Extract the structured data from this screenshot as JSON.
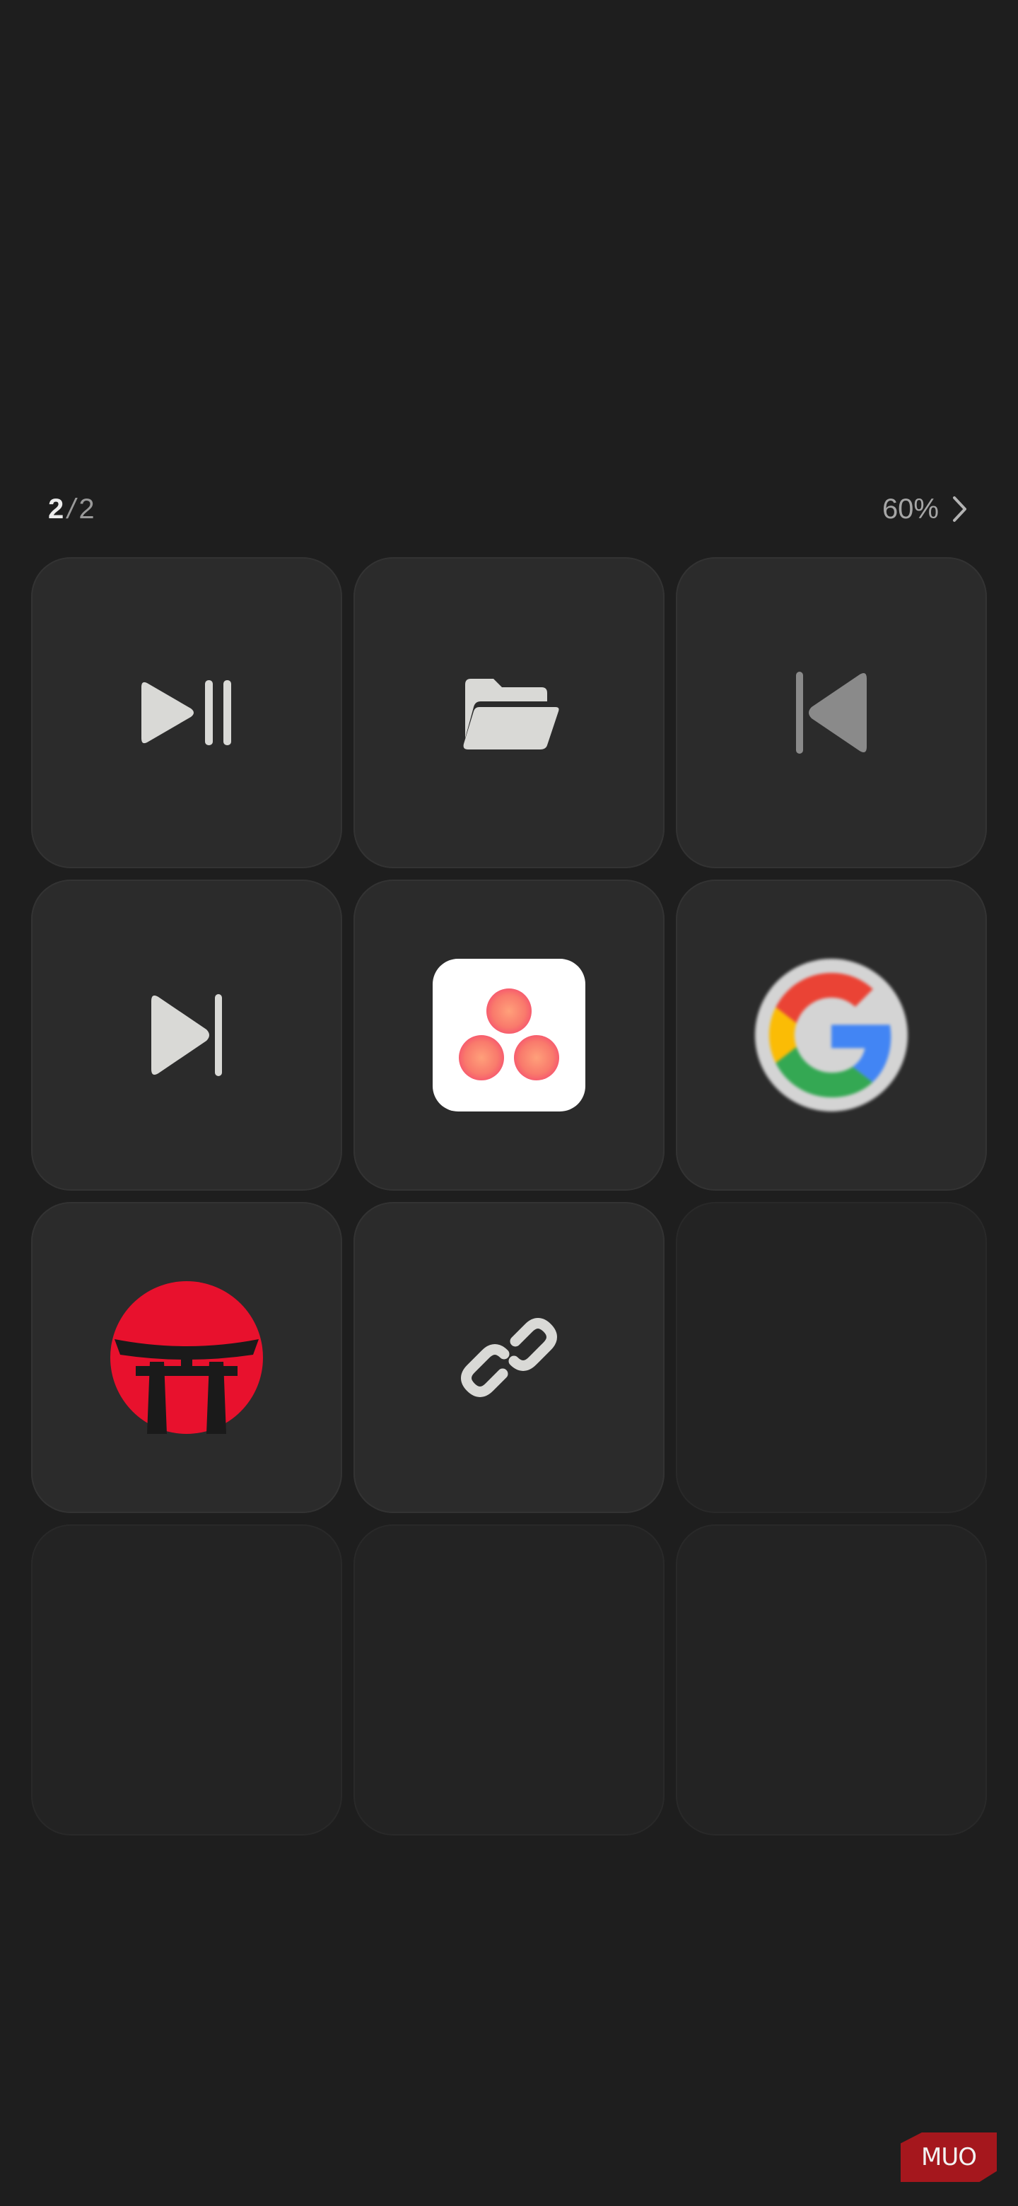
{
  "header": {
    "page_current": "2",
    "page_separator": "/",
    "page_total": "2",
    "zoom_label": "60%"
  },
  "tiles": [
    {
      "row": 1,
      "col": 1,
      "icon": "play-pause-icon",
      "color": "#d9d9d6"
    },
    {
      "row": 1,
      "col": 2,
      "icon": "folder-open-icon",
      "color": "#d9d9d6"
    },
    {
      "row": 1,
      "col": 3,
      "icon": "skip-previous-icon",
      "color": "#8a8a8a"
    },
    {
      "row": 2,
      "col": 1,
      "icon": "skip-next-icon",
      "color": "#d9d9d6"
    },
    {
      "row": 2,
      "col": 2,
      "icon": "asana-app-icon",
      "color": "#f5576c"
    },
    {
      "row": 2,
      "col": 3,
      "icon": "google-app-icon",
      "color": "#4285f4"
    },
    {
      "row": 3,
      "col": 1,
      "icon": "torii-gate-app-icon",
      "color": "#e8112d"
    },
    {
      "row": 3,
      "col": 2,
      "icon": "link-icon",
      "color": "#d9d9d6"
    },
    {
      "row": 3,
      "col": 3,
      "icon": "empty"
    },
    {
      "row": 4,
      "col": 1,
      "icon": "empty"
    },
    {
      "row": 4,
      "col": 2,
      "icon": "empty"
    },
    {
      "row": 4,
      "col": 3,
      "icon": "empty"
    }
  ],
  "watermark": {
    "text": "MUO",
    "color": "#a5171d"
  }
}
